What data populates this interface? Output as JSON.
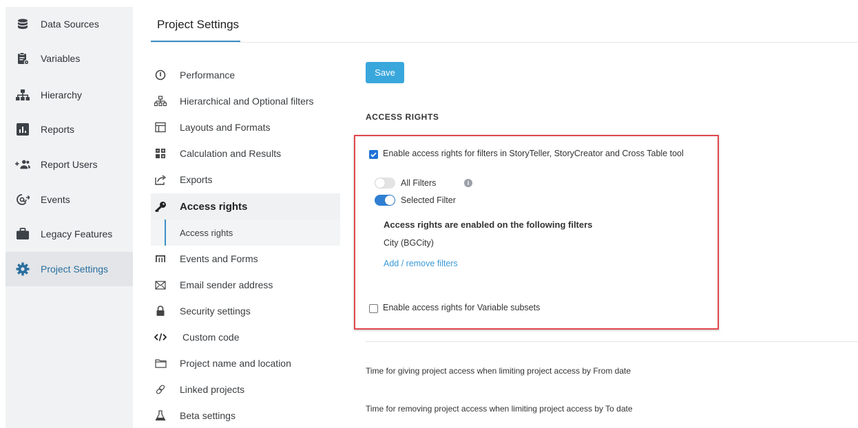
{
  "sidebar": {
    "items": [
      {
        "label": "Data Sources",
        "icon": "database-icon"
      },
      {
        "label": "Variables",
        "icon": "clipboard-gear-icon"
      },
      {
        "label": "Hierarchy",
        "icon": "hierarchy-icon"
      },
      {
        "label": "Reports",
        "icon": "bar-chart-icon"
      },
      {
        "label": "Report Users",
        "icon": "add-users-icon"
      },
      {
        "label": "Events",
        "icon": "events-icon"
      },
      {
        "label": "Legacy Features",
        "icon": "briefcase-icon"
      },
      {
        "label": "Project Settings",
        "icon": "gear-icon"
      }
    ],
    "active_index": 7
  },
  "header": {
    "title": "Project Settings"
  },
  "settings_menu": {
    "items": [
      {
        "label": "Performance",
        "icon": "performance-icon"
      },
      {
        "label": "Hierarchical and Optional filters",
        "icon": "hierarchy-filter-icon"
      },
      {
        "label": "Layouts and Formats",
        "icon": "layout-icon"
      },
      {
        "label": "Calculation and Results",
        "icon": "calculator-icon"
      },
      {
        "label": "Exports",
        "icon": "export-icon"
      },
      {
        "label": "Access rights",
        "icon": "key-icon"
      },
      {
        "label": "Access rights",
        "icon": ""
      },
      {
        "label": "Events and Forms",
        "icon": "events-forms-icon"
      },
      {
        "label": "Email sender address",
        "icon": "envelope-icon"
      },
      {
        "label": "Security settings",
        "icon": "lock-icon"
      },
      {
        "label": "Custom code",
        "icon": "code-icon"
      },
      {
        "label": "Project name and location",
        "icon": "folder-icon"
      },
      {
        "label": "Linked projects",
        "icon": "link-icon"
      },
      {
        "label": "Beta settings",
        "icon": "flask-icon"
      }
    ]
  },
  "main": {
    "save_label": "Save",
    "section_title": "ACCESS RIGHTS",
    "enable_filters_label": "Enable access rights for filters in StoryTeller, StoryCreator and Cross Table tool",
    "enable_filters_checked": true,
    "all_filters_label": "All Filters",
    "all_filters_on": false,
    "selected_filter_label": "Selected Filter",
    "selected_filter_on": true,
    "enabled_filters_heading": "Access rights are enabled on the following filters",
    "enabled_filters": [
      "City (BGCity)"
    ],
    "add_remove_label": "Add / remove filters",
    "enable_variables_label": "Enable access rights for Variable subsets",
    "enable_variables_checked": false,
    "from_date_label": "Time for giving project access when limiting project access by From date",
    "to_date_label": "Time for removing project access when limiting project access by To date"
  },
  "colors": {
    "accent": "#3b8fc6",
    "save_button": "#3aa7dc",
    "highlight_border": "#e0474c",
    "toggle_on": "#2f7fd3"
  }
}
